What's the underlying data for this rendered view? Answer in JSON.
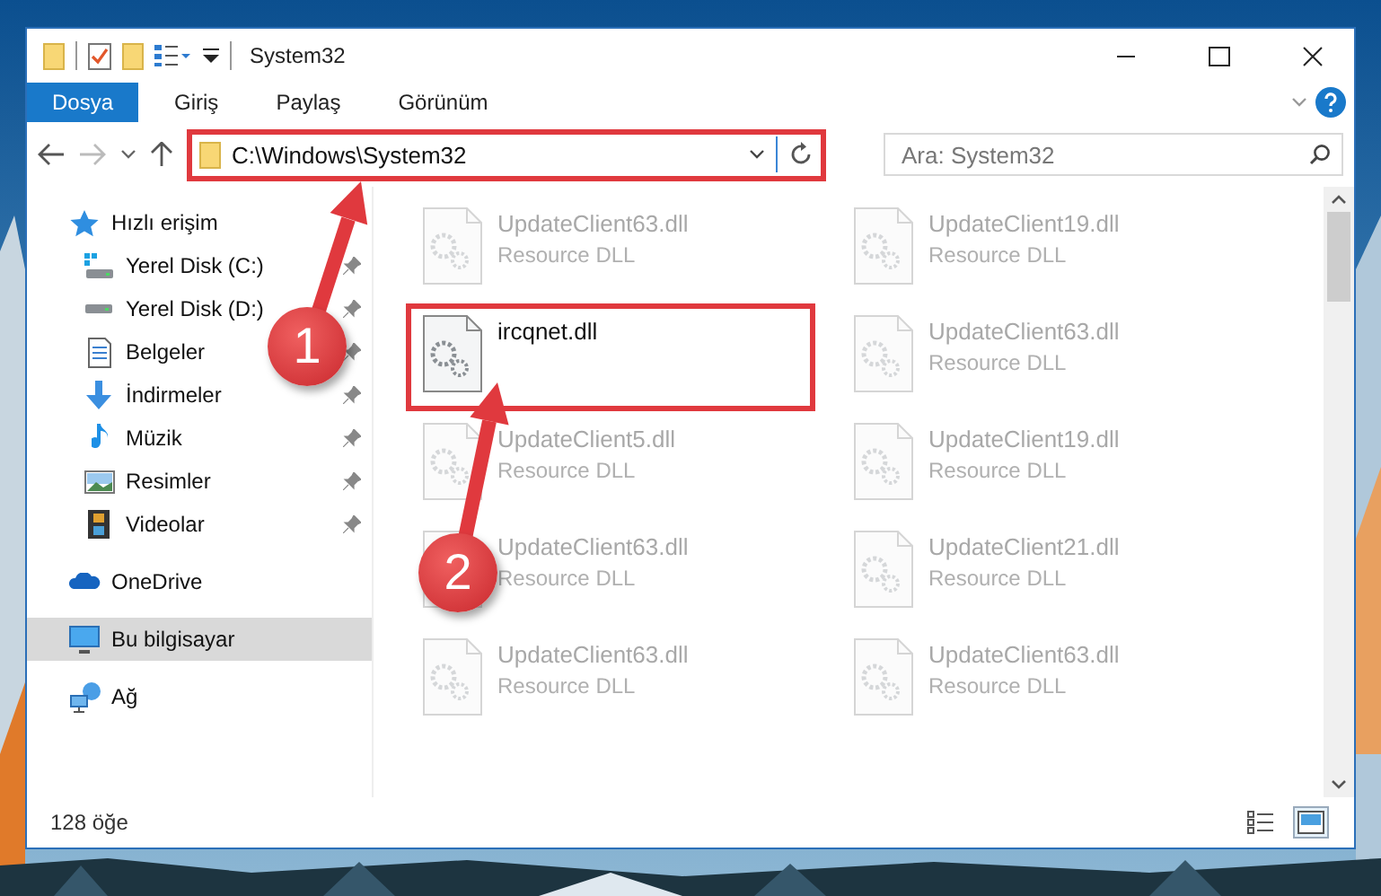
{
  "window": {
    "title": "System32"
  },
  "ribbon": {
    "tabs": [
      {
        "label": "Dosya",
        "kind": "file",
        "selected": false
      },
      {
        "label": "Giriş",
        "kind": "tab",
        "selected": false
      },
      {
        "label": "Paylaş",
        "kind": "tab",
        "selected": false
      },
      {
        "label": "Görünüm",
        "kind": "tab",
        "selected": false
      }
    ]
  },
  "navigation": {
    "back_disabled": false,
    "forward_disabled": true
  },
  "address_bar": {
    "path": "C:\\Windows\\System32",
    "highlighted": true
  },
  "search": {
    "placeholder": "Ara: System32"
  },
  "sidebar": {
    "items": [
      {
        "label": "Hızlı erişim",
        "selected": false,
        "children": [
          {
            "label": "Yerel Disk (C:)",
            "pinned": true,
            "selected": false
          },
          {
            "label": "Yerel Disk (D:)",
            "pinned": true,
            "selected": false
          },
          {
            "label": "Belgeler",
            "pinned": true,
            "selected": false
          },
          {
            "label": "İndirmeler",
            "pinned": true,
            "selected": false
          },
          {
            "label": "Müzik",
            "pinned": true,
            "selected": false
          },
          {
            "label": "Resimler",
            "pinned": true,
            "selected": false
          },
          {
            "label": "Videolar",
            "pinned": true,
            "selected": false
          }
        ]
      },
      {
        "label": "OneDrive",
        "selected": false
      },
      {
        "label": "Bu bilgisayar",
        "selected": true
      },
      {
        "label": "Ağ",
        "selected": false
      }
    ]
  },
  "files": [
    {
      "name": "UpdateClient63.dll",
      "type": "Resource DLL",
      "blurred": true,
      "highlighted": false
    },
    {
      "name": "UpdateClient19.dll",
      "type": "Resource DLL",
      "blurred": true,
      "highlighted": false
    },
    {
      "name": "ircqnet.dll",
      "blurred": false,
      "highlighted": true
    },
    {
      "name": "UpdateClient63.dll",
      "type": "Resource DLL",
      "blurred": true,
      "highlighted": false
    },
    {
      "name": "UpdateClient5.dll",
      "type": "Resource DLL",
      "blurred": true,
      "highlighted": false
    },
    {
      "name": "UpdateClient19.dll",
      "type": "Resource DLL",
      "blurred": true,
      "highlighted": false
    },
    {
      "name": "UpdateClient63.dll",
      "type": "Resource DLL",
      "blurred": true,
      "highlighted": false
    },
    {
      "name": "UpdateClient21.dll",
      "type": "Resource DLL",
      "blurred": true,
      "highlighted": false
    },
    {
      "name": "UpdateClient63.dll",
      "type": "Resource DLL",
      "blurred": true,
      "highlighted": false
    },
    {
      "name": "UpdateClient63.dll",
      "type": "Resource DLL",
      "blurred": true,
      "highlighted": false
    }
  ],
  "annotations": [
    {
      "number": "1"
    },
    {
      "number": "2"
    }
  ],
  "status_bar": {
    "count": "128 öğe",
    "views": [
      {
        "kind": "details",
        "selected": false
      },
      {
        "kind": "tiles",
        "selected": true
      }
    ]
  }
}
